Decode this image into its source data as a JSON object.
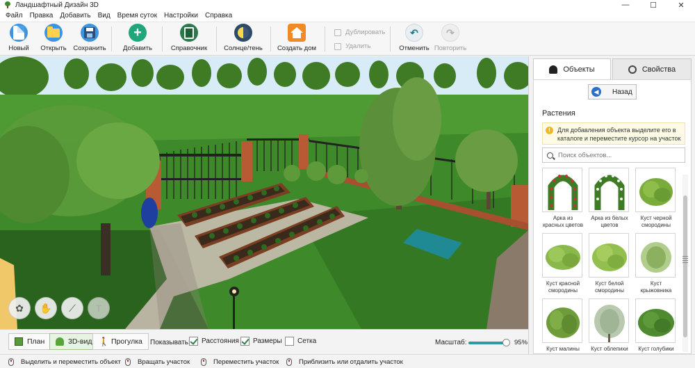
{
  "window": {
    "title": "Ландшафтный Дизайн 3D",
    "controls": [
      "—",
      "☐",
      "✕"
    ]
  },
  "menu": [
    "Файл",
    "Правка",
    "Добавить",
    "Вид",
    "Время суток",
    "Настройки",
    "Справка"
  ],
  "toolbar": {
    "new": "Новый",
    "open": "Открыть",
    "save": "Сохранить",
    "add": "Добавить",
    "reference": "Справочник",
    "sun_shadow": "Солнце/тень",
    "create_house": "Создать дом",
    "duplicate": "Дублировать",
    "delete": "Удалить",
    "undo": "Отменить",
    "redo": "Повторить"
  },
  "view_tools": [
    "orbit-icon",
    "hand-icon",
    "ruler-icon",
    "text-icon"
  ],
  "view_modes": {
    "plan": "План",
    "view3d": "3D-вид",
    "walk": "Прогулка",
    "active": "3D-вид"
  },
  "display": {
    "label": "Показывать:",
    "distances": {
      "label": "Расстояния",
      "checked": true
    },
    "sizes": {
      "label": "Размеры",
      "checked": true
    },
    "grid": {
      "label": "Сетка",
      "checked": false
    }
  },
  "scale": {
    "label": "Масштаб:",
    "value": "95%",
    "fraction": 0.95
  },
  "status": [
    "Выделить и переместить объект",
    "Вращать участок",
    "Переместить участок",
    "Приблизить или отдалить участок"
  ],
  "panel": {
    "tabs": {
      "objects": "Объекты",
      "properties": "Свойства"
    },
    "back": "Назад",
    "category": "Растения",
    "hint": "Для добавления объекта выделите его в каталоге и переместите курсор на участок",
    "search_placeholder": "Поиск объектов...",
    "items": [
      "Арка из красных цветов",
      "Арка из белых цветов",
      "Куст черной смородины",
      "Куст красной смородины",
      "Куст белой смородины",
      "Куст крыжовника",
      "Куст малины",
      "Куст облепихи",
      "Куст голубики"
    ]
  },
  "colors": {
    "accent": "#2e9ba3",
    "grass": "#3f8a2a",
    "sky": "#cfe8f7"
  }
}
